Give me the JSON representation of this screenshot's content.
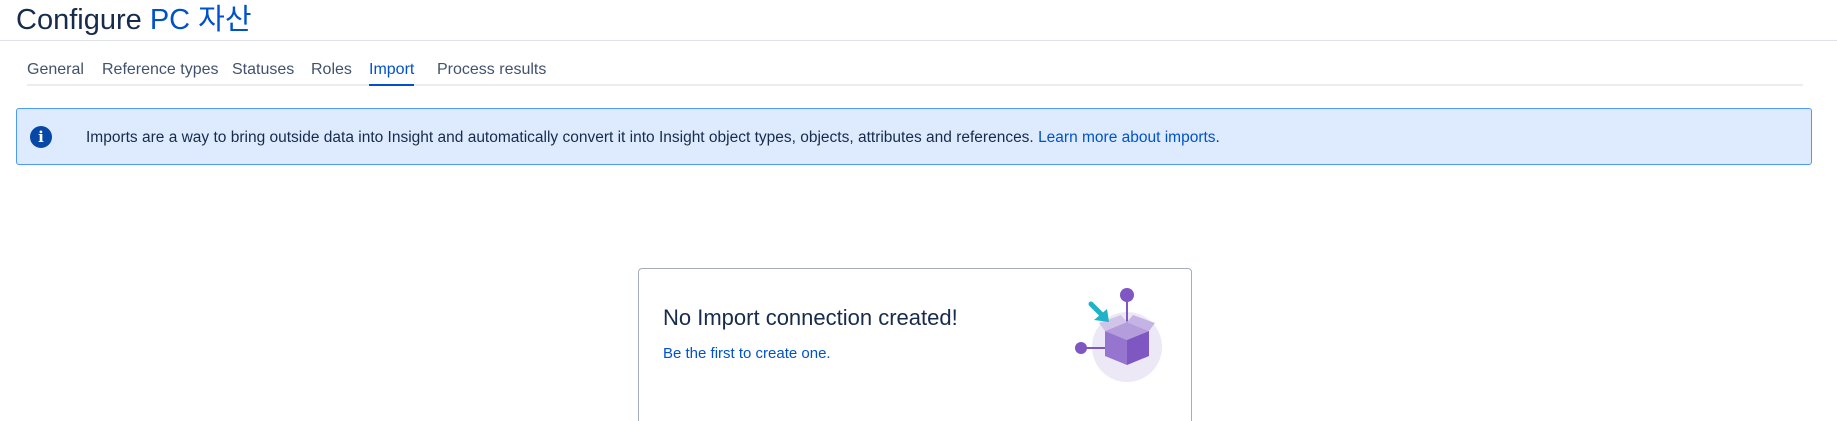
{
  "header": {
    "title_prefix": "Configure",
    "title_schema": "PC 자산"
  },
  "tabs": [
    {
      "label": "General",
      "active": false
    },
    {
      "label": "Reference types",
      "active": false
    },
    {
      "label": "Statuses",
      "active": false
    },
    {
      "label": "Roles",
      "active": false
    },
    {
      "label": "Import",
      "active": true
    },
    {
      "label": "Process results",
      "active": false
    }
  ],
  "info_banner": {
    "icon": "info-icon",
    "text": "Imports are a way to bring outside data into Insight and automatically convert it into Insight object types, objects, attributes and references.",
    "link_label": "Learn more about imports",
    "suffix": "."
  },
  "empty_state": {
    "title": "No Import connection created!",
    "link_label": "Be the first to create one.",
    "illustration": "import-box-illustration"
  },
  "colors": {
    "link": "#0052cc",
    "banner_bg": "#deebff",
    "banner_border": "#4c9aff",
    "illustration_purple": "#7e57c2",
    "illustration_teal": "#1fb3c9"
  }
}
